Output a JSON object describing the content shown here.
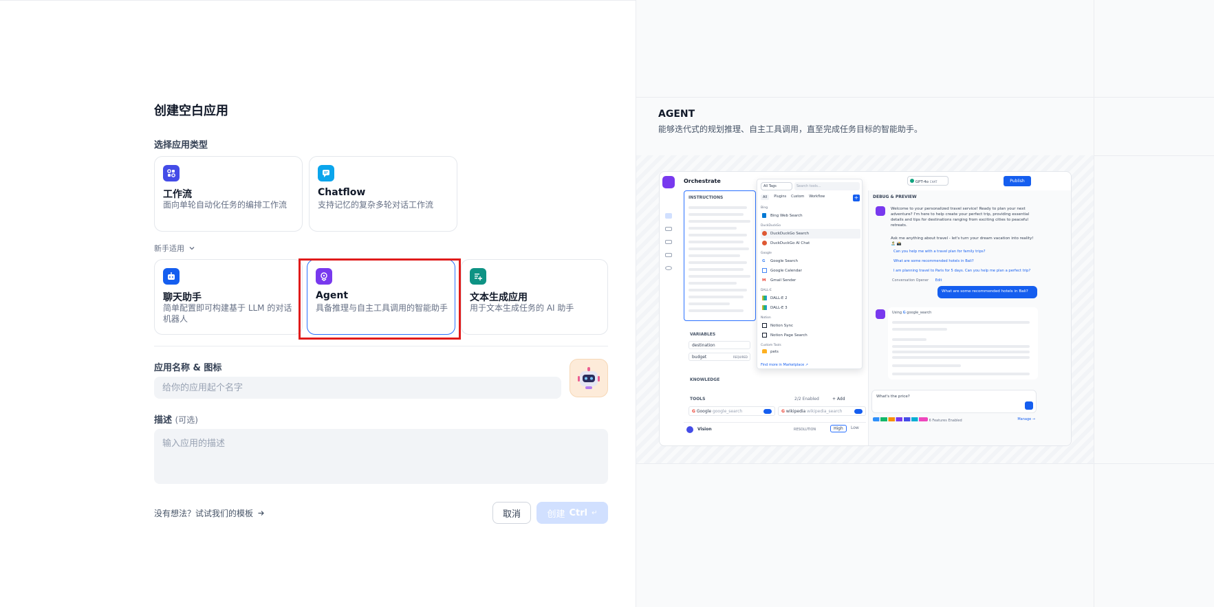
{
  "form": {
    "title": "创建空白应用",
    "type_label": "选择应用类型",
    "beginner_label": "新手适用",
    "types": [
      {
        "name": "工作流",
        "desc": "面向单轮自动化任务的编排工作流",
        "color": "#444ce7"
      },
      {
        "name": "Chatflow",
        "desc": "支持记忆的复杂多轮对话工作流",
        "color": "#0ba5ec"
      },
      {
        "name": "聊天助手",
        "desc": "简单配置即可构建基于 LLM 的对话机器人",
        "color": "#155eef"
      },
      {
        "name": "Agent",
        "desc": "具备推理与自主工具调用的智能助手",
        "color": "#7839ee"
      },
      {
        "name": "文本生成应用",
        "desc": "用于文本生成任务的 AI 助手",
        "color": "#0e9384"
      }
    ],
    "selected_type": "Agent",
    "name_label": "应用名称 & 图标",
    "name_placeholder": "给你的应用起个名字",
    "desc_label": "描述",
    "desc_optional": "(可选)",
    "desc_placeholder": "输入应用的描述",
    "template_link": "没有想法？试试我们的模板",
    "cancel_label": "取消",
    "create_label": "创建",
    "create_shortcut": "Ctrl"
  },
  "preview": {
    "title": "AGENT",
    "desc": "能够迭代式的规划推理、自主工具调用，直至完成任务目标的智能助手。",
    "orchestrate": "Orchestrate",
    "instructions": "INSTRUCTIONS",
    "variables": "VARIABLES",
    "var1": "destination",
    "var2": "budget",
    "required": "REQUIRED",
    "knowledge": "KNOWLEDGE",
    "tools": "TOOLS",
    "tools_enabled": "2/2 Enabled",
    "add": "+ Add",
    "tool1_name": "Google",
    "tool1_id": "google_search",
    "tool2_name": "wikipedia",
    "tool2_id": "wikipedia_search",
    "vision": "Vision",
    "resolution": "RESOLUTION",
    "high": "High",
    "low": "Low",
    "all_tags": "All Tags",
    "search_tools": "Search tools...",
    "filter_tabs": [
      "All",
      "Plugins",
      "Custom",
      "Workflow"
    ],
    "tool_groups": [
      {
        "group": "Bing",
        "items": [
          "Bing Web Search"
        ]
      },
      {
        "group": "DuckDuckGo",
        "items": [
          "DuckDuckGo Search",
          "DuckDuckGo AI Chat"
        ]
      },
      {
        "group": "Google",
        "items": [
          "Google Search",
          "Google Calendar",
          "Gmail Sender"
        ]
      },
      {
        "group": "DALL-E",
        "items": [
          "DALL-E 2",
          "DALL-E 3"
        ]
      },
      {
        "group": "Notion",
        "items": [
          "Notion Sync",
          "Notion Page Search"
        ]
      },
      {
        "group": "Custom Tools",
        "items": [
          "pets"
        ]
      }
    ],
    "find_more": "Find more in Marketplace ↗",
    "model": "GPT-4o",
    "model_tag": "CHAT",
    "publish": "Publish",
    "debug_title": "DEBUG & PREVIEW",
    "welcome": "Welcome to your personalized travel service! Ready to plan your next adventure? I'm here to help create your perfect trip, providing essential details and tips for destinations ranging from exciting cities to peaceful retreats.",
    "ask": "Ask me anything about travel - let's turn your dream vacation into reality! 🏝️ 📸",
    "suggestions": [
      "Can you help me with a travel plan for family trips?",
      "What are some recommended hotels in Bali?",
      "I am planning travel to Paris for 5 days. Can you help me plan a perfect trip?"
    ],
    "opener": "Conversation Opener",
    "edit": "Edit",
    "user_msg": "What are some recommended hotels in Bali?",
    "using": "Using",
    "using_tool": "google_search",
    "input_text": "What's the price?",
    "features": "6 Features Enabled",
    "manage": "Manage →"
  }
}
